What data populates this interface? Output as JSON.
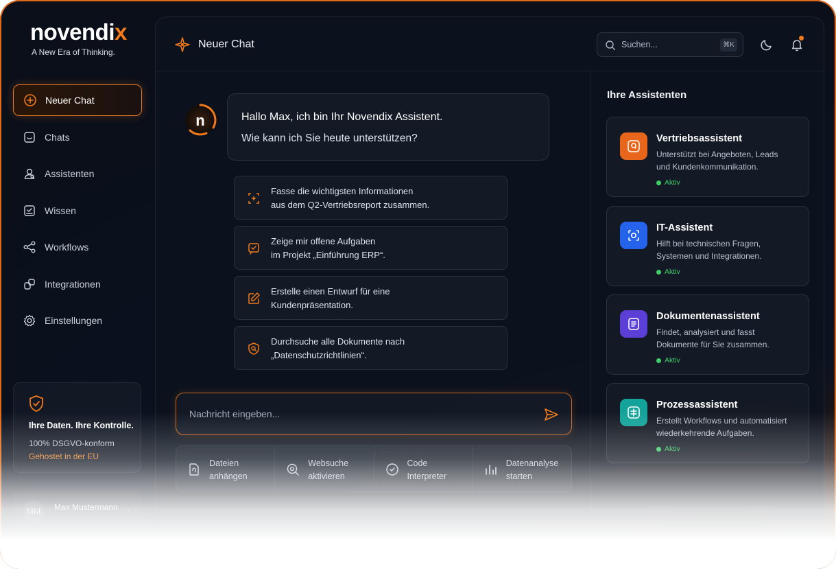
{
  "brand": {
    "name_main": "novendi",
    "name_accent": "x",
    "tagline": "A New Era of Thinking."
  },
  "sidebar": {
    "items": [
      {
        "label": "Neuer Chat",
        "icon": "plus-circle-icon",
        "active": true
      },
      {
        "label": "Chats",
        "icon": "chat-icon",
        "active": false
      },
      {
        "label": "Assistenten",
        "icon": "assistant-icon",
        "active": false
      },
      {
        "label": "Wissen",
        "icon": "knowledge-icon",
        "active": false
      },
      {
        "label": "Workflows",
        "icon": "workflow-icon",
        "active": false
      },
      {
        "label": "Integrationen",
        "icon": "integration-icon",
        "active": false
      },
      {
        "label": "Einstellungen",
        "icon": "gear-icon",
        "active": false
      }
    ],
    "privacy": {
      "title": "Ihre Daten. Ihre Kontrolle.",
      "line1": "100% DSGVO-konform",
      "line2": "Gehostet in der EU"
    },
    "user": {
      "initials": "MM",
      "name": "Max Mustermann"
    }
  },
  "header": {
    "title": "Neuer Chat",
    "search": {
      "placeholder": "Suchen...",
      "shortcut": "⌘K"
    }
  },
  "chat": {
    "greeting_line1": "Hallo Max, ich bin Ihr Novendix Assistent.",
    "greeting_line2": "Wie kann ich Sie heute unterstützen?",
    "suggestions": [
      {
        "line1": "Fasse die wichtigsten Informationen",
        "line2": "aus dem Q2-Vertriebsreport zusammen."
      },
      {
        "line1": "Zeige mir offene Aufgaben",
        "line2": "im Projekt „Einführung ERP“."
      },
      {
        "line1": "Erstelle einen Entwurf für eine",
        "line2": "Kundenpräsentation."
      },
      {
        "line1": "Durchsuche alle Dokumente nach",
        "line2": "„Datenschutzrichtlinien“."
      }
    ],
    "input_placeholder": "Nachricht eingeben...",
    "tools": [
      {
        "line1": "Dateien",
        "line2": "anhängen"
      },
      {
        "line1": "Websuche",
        "line2": "aktivieren"
      },
      {
        "line1": "Code",
        "line2": "Interpreter"
      },
      {
        "line1": "Datenanalyse",
        "line2": "starten"
      }
    ]
  },
  "assistants": {
    "title": "Ihre Assistenten",
    "items": [
      {
        "name": "Vertriebsassistent",
        "desc1": "Unterstützt bei Angeboten, Leads",
        "desc2": "und Kundenkommunikation.",
        "status": "Aktiv",
        "color": "#e8661c"
      },
      {
        "name": "IT-Assistent",
        "desc1": "Hilft bei technischen Fragen,",
        "desc2": "Systemen und Integrationen.",
        "status": "Aktiv",
        "color": "#2563eb"
      },
      {
        "name": "Dokumentenassistent",
        "desc1": "Findet, analysiert und fasst",
        "desc2": "Dokumente für Sie zusammen.",
        "status": "Aktiv",
        "color": "#5b3fd6"
      },
      {
        "name": "Prozessassistent",
        "desc1": "Erstellt Workflows und automatisiert",
        "desc2": "wiederkehrende Aufgaben.",
        "status": "Aktiv",
        "color": "#14a39a"
      }
    ]
  },
  "colors": {
    "accent": "#f27a1a",
    "status_active": "#3fcf6a"
  }
}
